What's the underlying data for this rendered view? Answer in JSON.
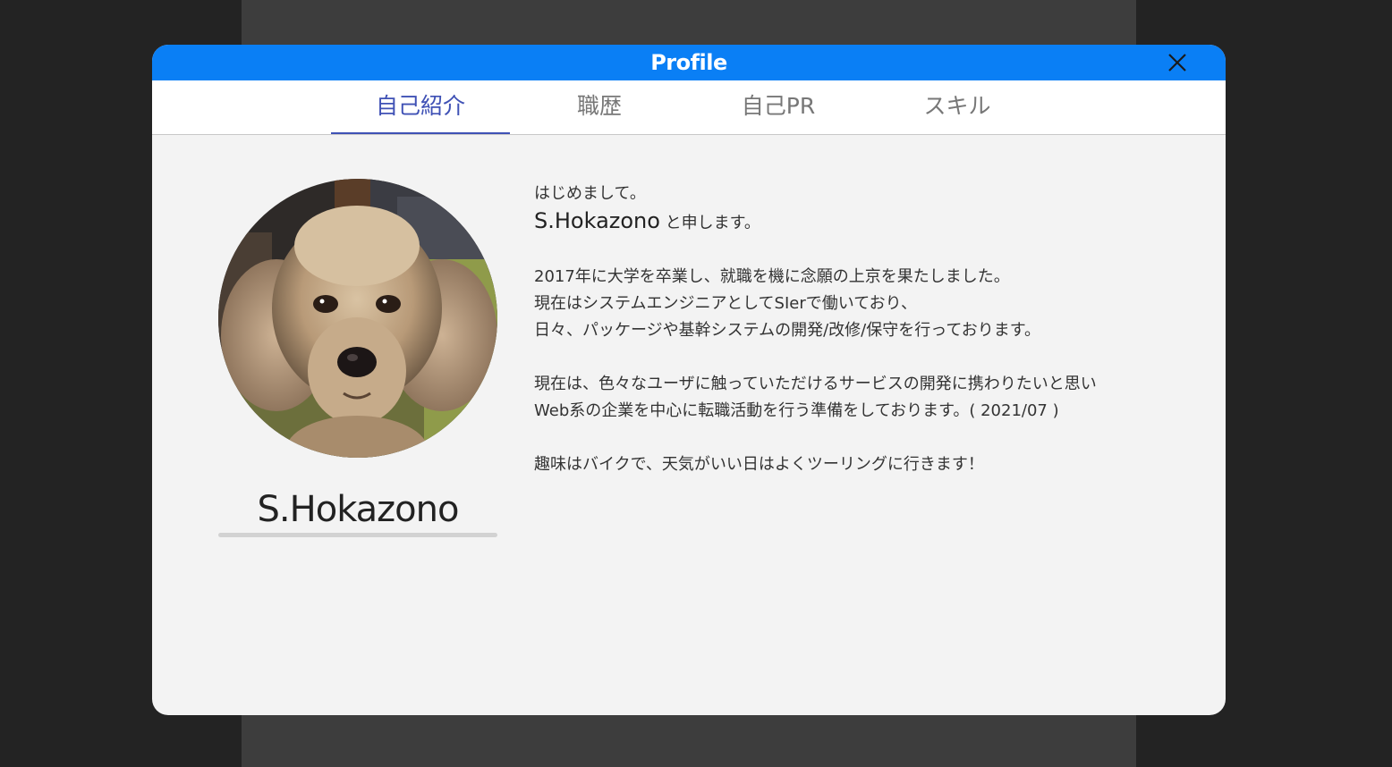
{
  "modal": {
    "title": "Profile",
    "close_icon": "close-icon"
  },
  "tabs": [
    {
      "label": "自己紹介",
      "active": true
    },
    {
      "label": "職歴",
      "active": false
    },
    {
      "label": "自己PR",
      "active": false
    },
    {
      "label": "スキル",
      "active": false
    }
  ],
  "profile": {
    "name": "S.Hokazono",
    "avatar_icon": "poodle-photo"
  },
  "intro": {
    "greeting": "はじめまして。",
    "name_line_name": "S.Hokazono",
    "name_line_suffix": " と申します。",
    "para1_line1": "2017年に大学を卒業し、就職を機に念願の上京を果たしました。",
    "para1_line2": "現在はシステムエンジニアとしてSIerで働いており、",
    "para1_line3": "日々、パッケージや基幹システムの開発/改修/保守を行っております。",
    "para2_line1": "現在は、色々なユーザに触っていただけるサービスの開発に携わりたいと思い",
    "para2_line2": "Web系の企業を中心に転職活動を行う準備をしております。( 2021/07 )",
    "para3_line1": "趣味はバイクで、天気がいい日はよくツーリングに行きます！"
  },
  "colors": {
    "header": "#0a7ff5",
    "active_tab": "#3f51b5",
    "backdrop": "#232323"
  }
}
